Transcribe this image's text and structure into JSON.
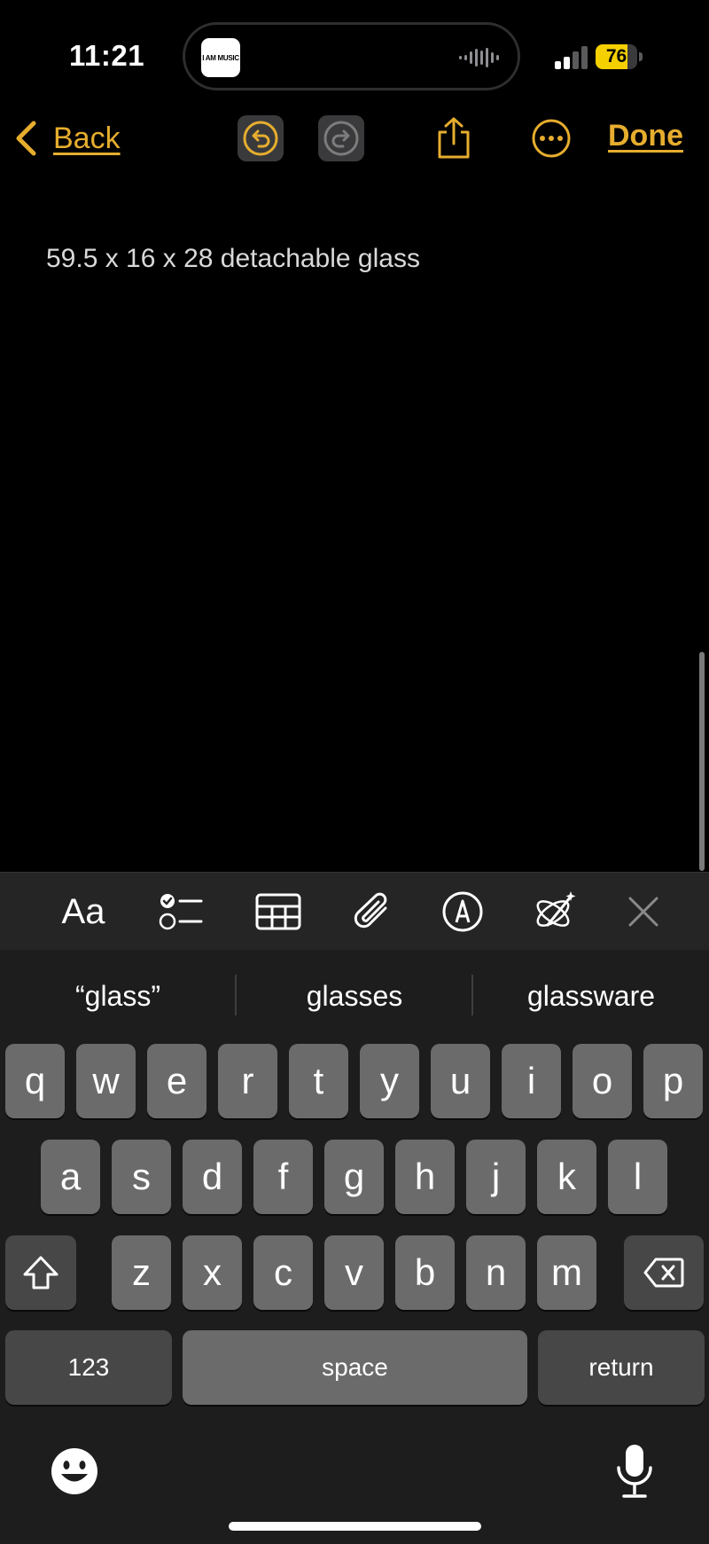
{
  "status_bar": {
    "time": "11:21",
    "island_app_label": "I AM MUSIC",
    "battery_percent": "76",
    "battery_level": 0.76
  },
  "toolbar": {
    "back_label": "Back",
    "done_label": "Done"
  },
  "note": {
    "text": "59.5 x 16 x 28 detachable glass"
  },
  "format_bar": {
    "text_style_label": "Aa"
  },
  "keyboard": {
    "suggestions": [
      "“glass”",
      "glasses",
      "glassware"
    ],
    "row1": [
      "q",
      "w",
      "e",
      "r",
      "t",
      "y",
      "u",
      "i",
      "o",
      "p"
    ],
    "row2": [
      "a",
      "s",
      "d",
      "f",
      "g",
      "h",
      "j",
      "k",
      "l"
    ],
    "row3": [
      "z",
      "x",
      "c",
      "v",
      "b",
      "n",
      "m"
    ],
    "numbers_label": "123",
    "space_label": "space",
    "return_label": "return"
  },
  "colors": {
    "accent": "#e6ad2e",
    "battery": "#f5d000",
    "background": "#000000",
    "keyboard_bg": "#1d1d1d",
    "key_bg": "#6b6b6b"
  }
}
